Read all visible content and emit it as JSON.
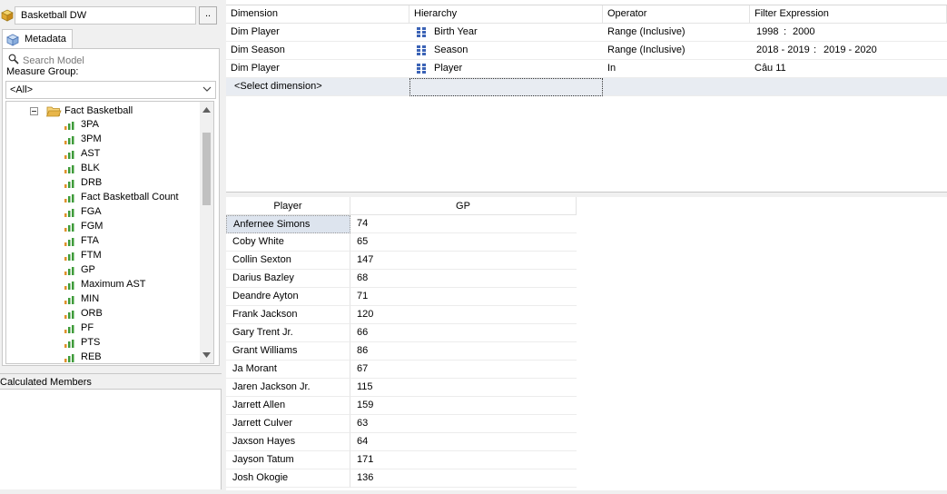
{
  "cube": {
    "name": "Basketball DW",
    "browse_label": ".."
  },
  "metadata": {
    "tab_label": "Metadata",
    "search_placeholder": "Search Model",
    "measure_group_label": "Measure Group:",
    "measure_group_value": "<All>",
    "tree_root": "Fact Basketball",
    "measures": [
      "3PA",
      "3PM",
      "AST",
      "BLK",
      "DRB",
      "Fact Basketball Count",
      "FGA",
      "FGM",
      "FTA",
      "FTM",
      "GP",
      "Maximum AST",
      "MIN",
      "ORB",
      "PF",
      "PTS",
      "REB"
    ]
  },
  "calculated_members_label": "Calculated Members",
  "filter": {
    "headers": [
      "Dimension",
      "Hierarchy",
      "Operator",
      "Filter Expression"
    ],
    "rows": [
      {
        "dimension": "Dim Player",
        "hierarchy": "Birth Year",
        "operator": "Range (Inclusive)",
        "from": "1998",
        "sep": ":",
        "to": "2000"
      },
      {
        "dimension": "Dim Season",
        "hierarchy": "Season",
        "operator": "Range (Inclusive)",
        "from": "2018 - 2019",
        "sep": ":",
        "to": "2019 - 2020"
      },
      {
        "dimension": "Dim Player",
        "hierarchy": "Player",
        "operator": "In",
        "expression": "Câu 11"
      }
    ],
    "select_placeholder": "<Select dimension>"
  },
  "results": {
    "headers": [
      "Player",
      "GP"
    ],
    "rows": [
      {
        "player": "Anfernee Simons",
        "gp": "74"
      },
      {
        "player": "Coby White",
        "gp": "65"
      },
      {
        "player": "Collin Sexton",
        "gp": "147"
      },
      {
        "player": "Darius Bazley",
        "gp": "68"
      },
      {
        "player": "Deandre Ayton",
        "gp": "71"
      },
      {
        "player": "Frank Jackson",
        "gp": "120"
      },
      {
        "player": "Gary Trent Jr.",
        "gp": "66"
      },
      {
        "player": "Grant Williams",
        "gp": "86"
      },
      {
        "player": "Ja Morant",
        "gp": "67"
      },
      {
        "player": "Jaren Jackson Jr.",
        "gp": "115"
      },
      {
        "player": "Jarrett Allen",
        "gp": "159"
      },
      {
        "player": "Jarrett Culver",
        "gp": "63"
      },
      {
        "player": "Jaxson Hayes",
        "gp": "64"
      },
      {
        "player": "Jayson Tatum",
        "gp": "171"
      },
      {
        "player": "Josh Okogie",
        "gp": "136"
      }
    ]
  },
  "colors": {
    "panel_bg": "#f0f0f0",
    "selection_bg": "#dde4ee",
    "folder": "#e8b64a",
    "measure_green": "#3e9b3a",
    "measure_orange": "#e0912b",
    "hierarchy_blue": "#3b63b6"
  }
}
